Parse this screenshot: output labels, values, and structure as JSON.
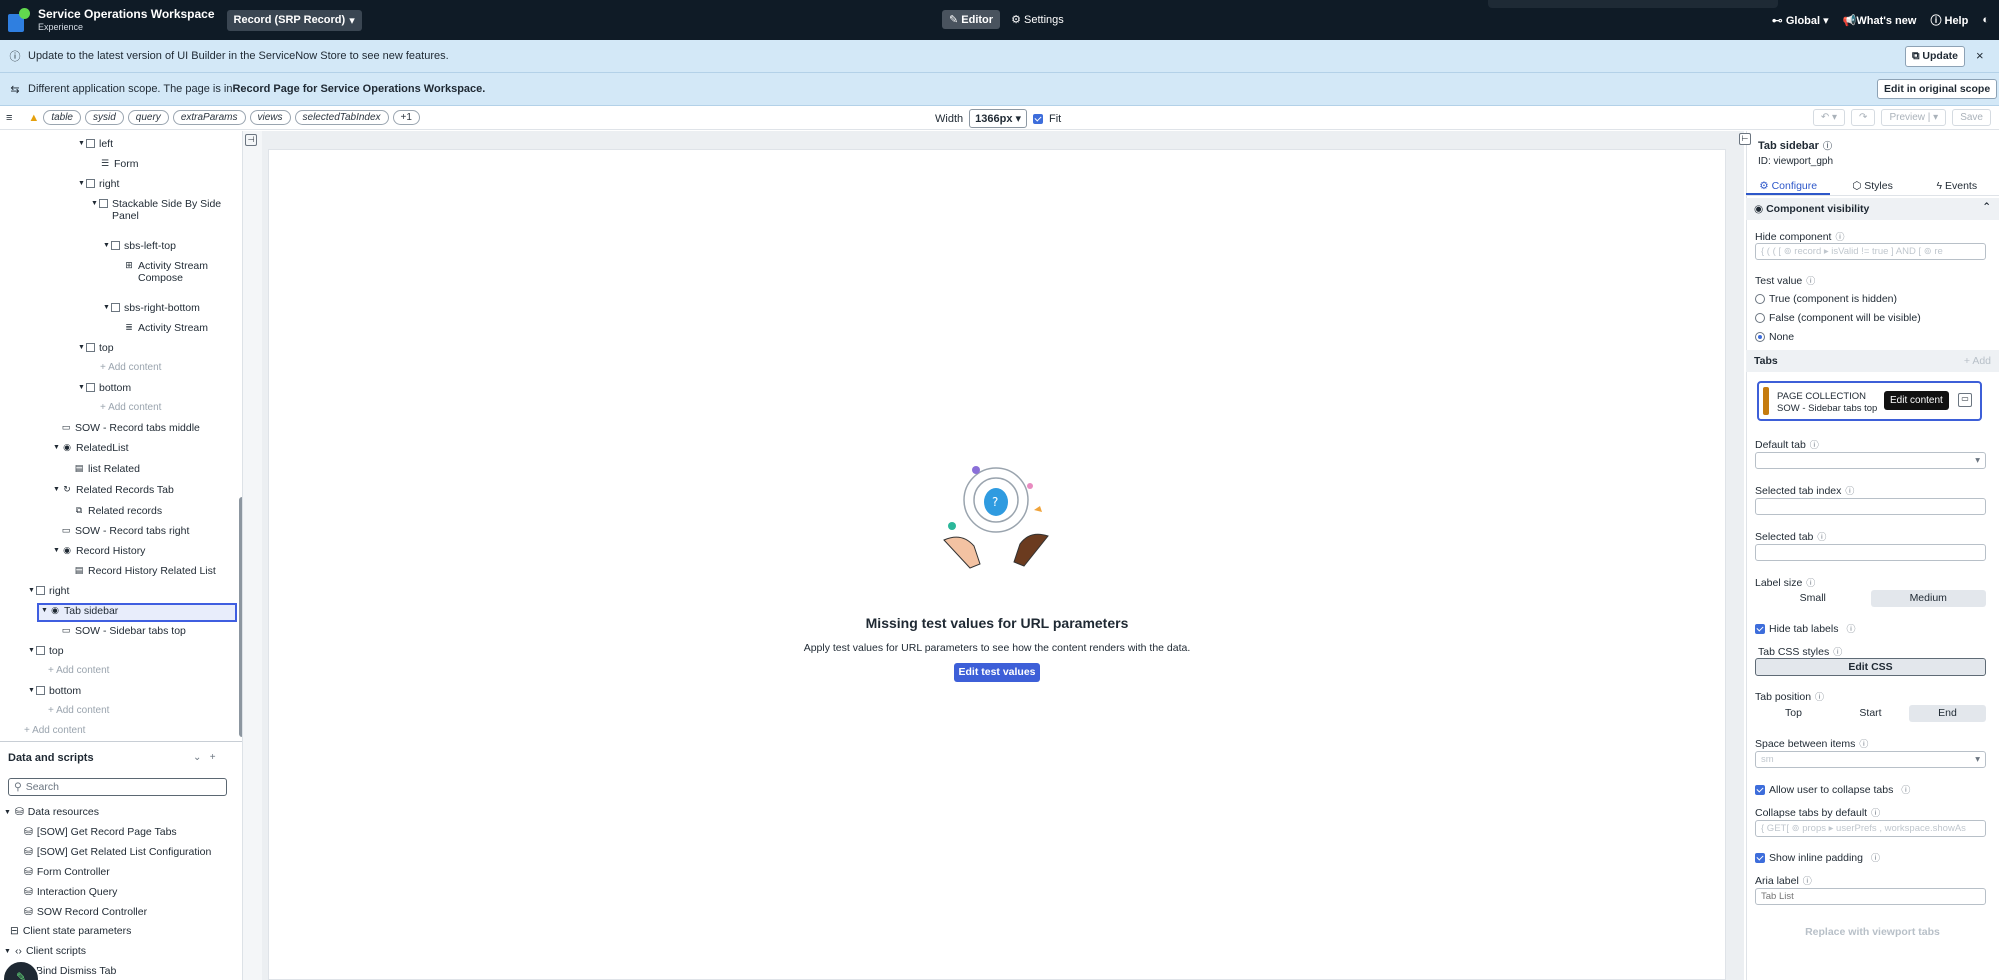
{
  "topbar": {
    "workspace_title": "Service Operations Workspace",
    "workspace_sub": "Experience",
    "page_select": "Record (SRP Record)",
    "editor_tab": "Editor",
    "settings_tab": "Settings",
    "global": "Global",
    "whats_new": "What's new",
    "help": "Help"
  },
  "banner_update": {
    "text": "Update to the latest version of UI Builder in the ServiceNow Store to see new features.",
    "button": "Update"
  },
  "banner_scope": {
    "text_prefix": "Different application scope. The page is in ",
    "text_bold": "Record Page for Service Operations Workspace.",
    "button": "Edit in original scope"
  },
  "parambar": {
    "chips": [
      "table",
      "sysid",
      "query",
      "extraParams",
      "views",
      "selectedTabIndex",
      "+1"
    ],
    "width_label": "Width",
    "width_value": "1366px",
    "fit_label": "Fit",
    "preview": "Preview",
    "save": "Save"
  },
  "tree": {
    "nodes": [
      "left",
      "Form",
      "right",
      "Stackable Side By Side",
      "Panel",
      "sbs-left-top",
      "Activity Stream",
      "Compose",
      "sbs-right-bottom",
      "Activity Stream",
      "top",
      "bottom",
      "SOW - Record tabs middle",
      "RelatedList",
      "list Related",
      "Related Records Tab",
      "Related records",
      "SOW - Record tabs right",
      "Record History",
      "Record History Related List",
      "right",
      "Tab sidebar",
      "SOW - Sidebar tabs top",
      "top",
      "bottom"
    ],
    "add_content": "Add content"
  },
  "data_scripts": {
    "title": "Data and scripts",
    "search_placeholder": "Search",
    "items": [
      "Data resources",
      "[SOW] Get Record Page Tabs",
      "[SOW] Get Related List Configuration",
      "Form Controller",
      "Interaction Query",
      "SOW Record Controller",
      "Client state parameters",
      "Client scripts",
      "Bind Dismiss Tab"
    ]
  },
  "canvas": {
    "title": "Missing test values for URL parameters",
    "desc": "Apply test values for URL parameters to see how the content renders with the data.",
    "button": "Edit test values"
  },
  "panel": {
    "title": "Tab sidebar",
    "id": "ID: viewport_gph",
    "tabs": [
      "Configure",
      "Styles",
      "Events"
    ],
    "visibility": "Component visibility",
    "hide_component": "Hide component",
    "hide_value": "{ ( ( [ ⊚ record ▸ isValid != true ] AND [ ⊚ re",
    "test_value": "Test value",
    "radio_true": "True (component is hidden)",
    "radio_false": "False (component will be visible)",
    "radio_none": "None",
    "tabs_section": "Tabs",
    "add": "+ Add",
    "card_line1": "PAGE COLLECTION",
    "card_line2": "SOW - Sidebar tabs top",
    "tooltip": "Edit content",
    "default_tab": "Default tab",
    "selected_tab_index": "Selected tab index",
    "selected_tab": "Selected tab",
    "label_size": "Label size",
    "size_small": "Small",
    "size_medium": "Medium",
    "hide_tab_labels": "Hide tab labels",
    "tab_css": "Tab CSS styles",
    "edit_css": "Edit CSS",
    "tab_position": "Tab position",
    "pos_top": "Top",
    "pos_start": "Start",
    "pos_end": "End",
    "space_between": "Space between items",
    "space_value": "sm",
    "allow_collapse": "Allow user to collapse tabs",
    "collapse_default": "Collapse tabs by default",
    "collapse_value": "{ GET[ ⊚ props ▸ userPrefs , workspace.showAs",
    "inline_padding": "Show inline padding",
    "aria_label": "Aria label",
    "aria_placeholder": "Tab List",
    "replace": "Replace with viewport tabs"
  }
}
